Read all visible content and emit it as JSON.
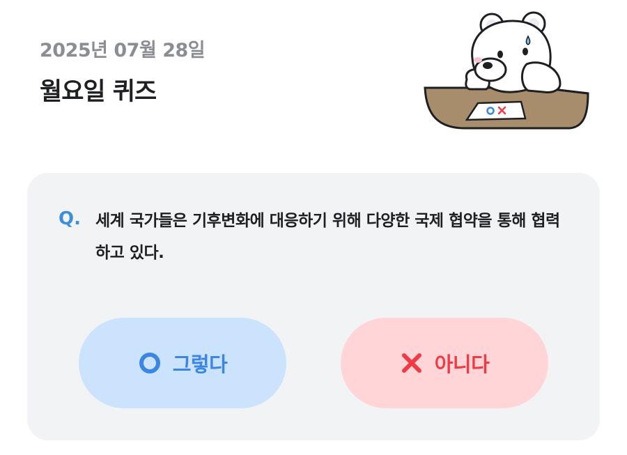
{
  "header": {
    "date": "2025년 07월 28일",
    "title": "월요일 퀴즈"
  },
  "mascot": {
    "icon": "polar-bear-thinking-illustration",
    "paper_text": "OX"
  },
  "quiz": {
    "q_mark": "Q.",
    "question": "세계 국가들은 기후변화에 대응하기 위해 다양한 국제 협약을 통해 협력하고 있다."
  },
  "answers": {
    "yes": {
      "label": "그렇다",
      "icon": "circle-o-icon"
    },
    "no": {
      "label": "아니다",
      "icon": "x-mark-icon"
    }
  },
  "colors": {
    "card_bg": "#f2f3f5",
    "accent_blue": "#3b86e3",
    "accent_red": "#ef3b45",
    "yes_bg": "#cce3fd",
    "no_bg": "#ffd5d8"
  }
}
